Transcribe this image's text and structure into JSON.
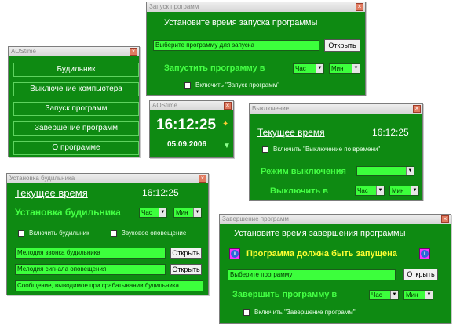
{
  "main_menu": {
    "title": "AOStime",
    "buttons": [
      "Будильник",
      "Выключение компьютера",
      "Запуск программ",
      "Завершение программ",
      "О программе"
    ]
  },
  "launch": {
    "title": "Запуск программ",
    "heading": "Установите время запуска программы",
    "field_placeholder": "Выберите программу для запуска",
    "open_label": "Открыть",
    "run_label": "Запустить программу в",
    "hour_label": "Час",
    "min_label": "Мин",
    "checkbox_label": "Включить \"Запуск программ\""
  },
  "clock": {
    "title": "AOStime",
    "time": "16:12:25",
    "date": "05.09.2006"
  },
  "shutdown": {
    "title": "Выключение",
    "current_label": "Текущее время",
    "current_time": "16:12:25",
    "checkbox_label": "Включить \"Выключение по времени\"",
    "mode_label": "Режим выключения",
    "off_label": "Выключить в",
    "hour_label": "Час",
    "min_label": "Мин"
  },
  "alarm": {
    "title": "Установка будильника",
    "current_label": "Текущее время",
    "current_time": "16:12:25",
    "set_label": "Установка будильника",
    "hour_label": "Час",
    "min_label": "Мин",
    "enable_label": "Включить будильник",
    "voice_label": "Звуковое оповещение",
    "melody_field": "Мелодия звонка будильника",
    "signal_field": "Мелодия сигнала оповещения",
    "open_label": "Открыть",
    "message_field": "Сообщение, выводимое при срабатывании будильника"
  },
  "terminate": {
    "title": "Завершение программ",
    "heading": "Установите время завершения программы",
    "warning": "Программа должна быть запущена",
    "field_placeholder": "Выберите программу",
    "open_label": "Открыть",
    "end_label": "Завершить программу в",
    "hour_label": "Час",
    "min_label": "Мин",
    "checkbox_label": "Включить \"Завершение программ\""
  },
  "colors": {
    "window_bg": "#0e8a12",
    "field_bg": "#3cff3c",
    "accent_lime": "#44ff44",
    "warning_yellow": "#ffff33"
  }
}
